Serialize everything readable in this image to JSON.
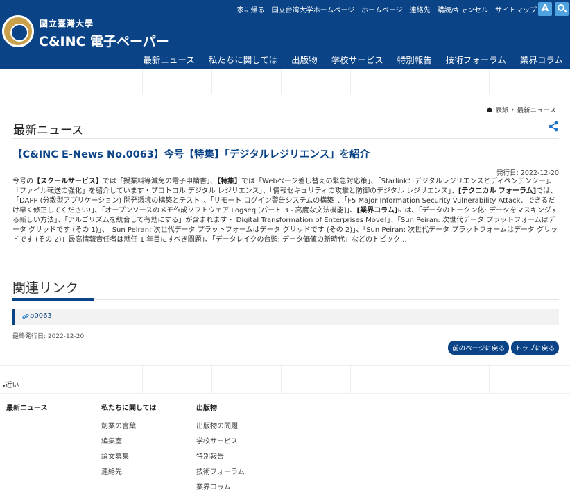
{
  "header": {
    "top_links": [
      "家に帰る",
      "国立台湾大学ホームページ",
      "ホームページ",
      "連絡先",
      "購読/キャンセル",
      "サイトマップ"
    ],
    "font_size_button": "A",
    "university_name": "國立臺灣大學",
    "site_title": "C&INC 電子ペーパー",
    "nav": [
      "最新ニュース",
      "私たちに関しては",
      "出版物",
      "学校サービス",
      "特別報告",
      "技術フォーラム",
      "業界コラム"
    ],
    "brand_color": "#0b4387"
  },
  "breadcrumb": {
    "home": "表紙",
    "separator": "›",
    "current": "最新ニュース"
  },
  "page": {
    "title": "最新ニュース"
  },
  "article": {
    "title": "【C&INC E-News No.0063】今号【特集】「デジタルレジリエンス」を紹介",
    "publish_date": "発行日: 2022-12-20",
    "body": [
      {
        "t": "今号の"
      },
      {
        "t": "【スクールサービス】",
        "b": true
      },
      {
        "t": "では「授業料等減免の電子申請書」、"
      },
      {
        "t": "【特集】",
        "b": true
      },
      {
        "t": "では「Webページ差し替えの緊急対応策」、「Starlink：デジタルレジリエンスとディペンデンシー」、「ファイル転送の強化」を紹介しています・プロトコル デジタル レジリエンス」、「情報セキュリティの攻撃と防御のデジタル レジリエンス」、"
      },
      {
        "t": "[テクニカル フォーラム]",
        "b": true
      },
      {
        "t": "では、「DAPP (分散型アプリケーション) 開発環境の構築とテスト」、「リモート ログイン警告システムの構築」、「F5 Major Information Security Vulnerability Attack、できるだけ早く修正してください!」、「オープンソースのメモ作成ソフトウェア Logseq [パート 3 - 高度な文法機能]」、"
      },
      {
        "t": "[業界コラム]",
        "b": true
      },
      {
        "t": "には、「データのトークン化: データをマスキングする新しい方法」、「アルゴリズムを統合して有効にする」が含まれます・ Digital Transformation of Enterprises Move!」、「Sun Peiran: 次世代データ プラットフォームはデータ グリッドです (その 1)」、「Sun Peiran: 次世代データ プラットフォームはデータ グリッドです (その 2)」、「Sun Peiran: 次世代データ プラットフォームはデータ グリッドです (その 2)」最高情報責任者は就任 1 年目にすべき問題」、「データレイクの台頭: データ価値の新時代」などのトピック..."
      }
    ]
  },
  "related": {
    "title": "関連リンク",
    "link": "p0063",
    "last_published": "最終発行日: 2022-12-20"
  },
  "buttons": {
    "back": "前のページに戻る",
    "top": "トップに戻る"
  },
  "footer": {
    "near_label": "近い",
    "columns": [
      {
        "heading": "最新ニュース",
        "items": []
      },
      {
        "heading": "私たちに関しては",
        "items": [
          "創業の言葉",
          "編集室",
          "論文募集",
          "連絡先"
        ]
      },
      {
        "heading": "出版物",
        "items": [
          "出版物の問題",
          "学校サービス",
          "特別報告",
          "技術フォーラム",
          "業界コラム"
        ]
      }
    ]
  }
}
